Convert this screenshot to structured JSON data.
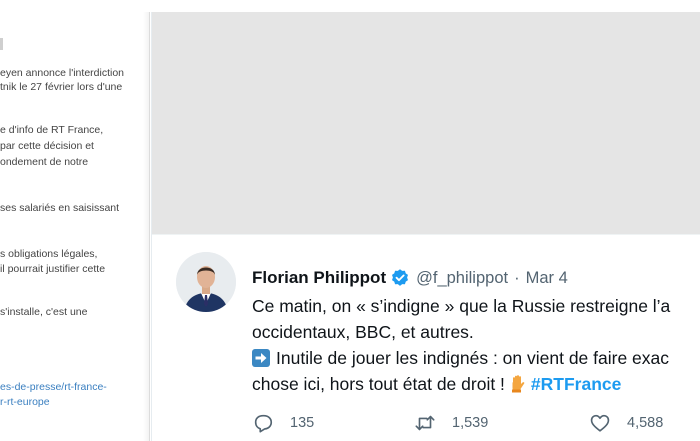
{
  "document": {
    "lines": [
      "eyen annonce l'interdiction",
      "tnik le 27 février lors d'une",
      "e d'info de RT France,",
      "par cette décision et",
      "ondement de notre",
      "ses salariés en saisissant",
      "s obligations légales,",
      "il pourrait justifier cette",
      "s'installe, c'est une",
      "es-de-presse/rt-france-",
      "r-rt-europe"
    ]
  },
  "tweet": {
    "name": "Florian Philippot",
    "handle": "@f_philippot",
    "separator": "·",
    "date": "Mar 4",
    "line1": "Ce matin, on « s’indigne » que la Russie restreigne l’a",
    "line2": "occidentaux, BBC, et autres.",
    "line3": "Inutile de jouer les indignés : on vient de faire exac",
    "line4": "chose ici, hors tout état de droit !",
    "hashtag": "#RTFrance",
    "replies": "135",
    "retweets": "1,539",
    "likes": "4,588"
  },
  "icons": {
    "verified": "verified-badge-icon",
    "arrow": "right-arrow-emoji-icon",
    "hand": "raised-hand-emoji-icon",
    "reply": "reply-icon",
    "retweet": "retweet-icon",
    "like": "heart-icon"
  },
  "colors": {
    "link": "#1d9bf0",
    "text": "#0f1419",
    "muted": "#536471",
    "media_bg": "#e5e5e5"
  }
}
